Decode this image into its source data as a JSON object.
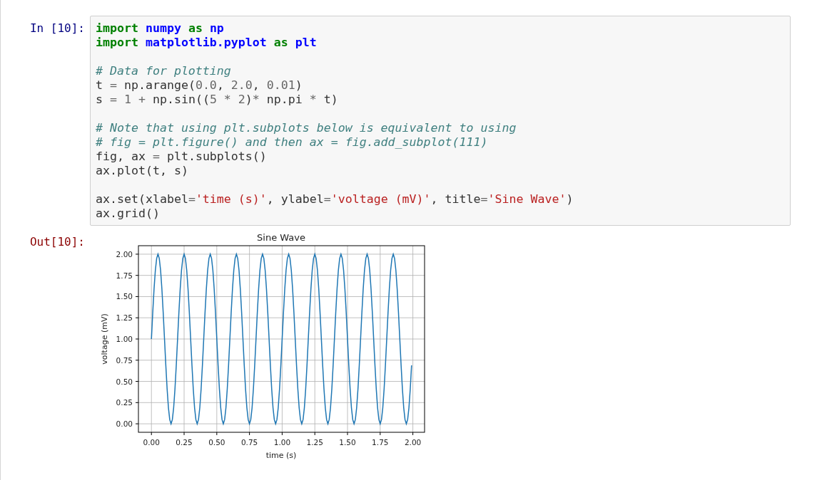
{
  "input_cell": {
    "prompt": "In [10]:",
    "code_blocks": [
      [
        [
          {
            "text": "import",
            "kind": "keyword"
          },
          {
            "text": " numpy",
            "kind": "name"
          },
          {
            "text": " as",
            "kind": "keyword"
          },
          {
            "text": " np",
            "kind": "name"
          }
        ],
        [
          {
            "text": "import",
            "kind": "keyword"
          },
          {
            "text": " matplotlib.pyplot",
            "kind": "name"
          },
          {
            "text": " as",
            "kind": "keyword"
          },
          {
            "text": " plt",
            "kind": "name"
          }
        ]
      ],
      [
        [
          {
            "text": "# Data for plotting",
            "kind": "comment"
          }
        ],
        [
          {
            "text": "t ",
            "kind": "plain"
          },
          {
            "text": "=",
            "kind": "operator"
          },
          {
            "text": " np.arange(",
            "kind": "plain"
          },
          {
            "text": "0.0",
            "kind": "number"
          },
          {
            "text": ", ",
            "kind": "plain"
          },
          {
            "text": "2.0",
            "kind": "number"
          },
          {
            "text": ", ",
            "kind": "plain"
          },
          {
            "text": "0.01",
            "kind": "number"
          },
          {
            "text": ")",
            "kind": "plain"
          }
        ],
        [
          {
            "text": "s ",
            "kind": "plain"
          },
          {
            "text": "=",
            "kind": "operator"
          },
          {
            "text": " 1",
            "kind": "number"
          },
          {
            "text": " +",
            "kind": "operator"
          },
          {
            "text": " np.sin((",
            "kind": "plain"
          },
          {
            "text": "5",
            "kind": "number"
          },
          {
            "text": " *",
            "kind": "operator"
          },
          {
            "text": " 2",
            "kind": "number"
          },
          {
            "text": ")",
            "kind": "plain"
          },
          {
            "text": "*",
            "kind": "operator"
          },
          {
            "text": " np.pi ",
            "kind": "plain"
          },
          {
            "text": "*",
            "kind": "operator"
          },
          {
            "text": " t)",
            "kind": "plain"
          }
        ]
      ],
      [
        [
          {
            "text": "# Note that using plt.subplots below is equivalent to using",
            "kind": "comment"
          }
        ],
        [
          {
            "text": "# fig = plt.figure() and then ax = fig.add_subplot(111)",
            "kind": "comment"
          }
        ],
        [
          {
            "text": "fig, ax ",
            "kind": "plain"
          },
          {
            "text": "=",
            "kind": "operator"
          },
          {
            "text": " plt.subplots()",
            "kind": "plain"
          }
        ],
        [
          {
            "text": "ax.plot(t, s)",
            "kind": "plain"
          }
        ]
      ],
      [
        [
          {
            "text": "ax.set(xlabel",
            "kind": "plain"
          },
          {
            "text": "=",
            "kind": "operator"
          },
          {
            "text": "'time (s)'",
            "kind": "string"
          },
          {
            "text": ", ylabel",
            "kind": "plain"
          },
          {
            "text": "=",
            "kind": "operator"
          },
          {
            "text": "'voltage (mV)'",
            "kind": "string"
          },
          {
            "text": ", title",
            "kind": "plain"
          },
          {
            "text": "=",
            "kind": "operator"
          },
          {
            "text": "'Sine Wave'",
            "kind": "string"
          },
          {
            "text": ")",
            "kind": "plain"
          }
        ],
        [
          {
            "text": "ax.grid()",
            "kind": "plain"
          }
        ]
      ]
    ]
  },
  "output_cell": {
    "prompt": "Out[10]:",
    "chart_data": {
      "type": "line",
      "title": "Sine Wave",
      "xlabel": "time (s)",
      "ylabel": "voltage (mV)",
      "x": [
        0,
        0.01,
        0.02,
        0.03,
        0.04,
        0.05,
        0.06,
        0.07,
        0.08,
        0.09,
        0.1,
        0.11,
        0.12,
        0.13,
        0.14,
        0.15,
        0.16,
        0.17,
        0.18,
        0.19,
        0.2,
        0.21,
        0.22,
        0.23,
        0.24,
        0.25,
        0.26,
        0.27,
        0.28,
        0.29,
        0.3,
        0.31,
        0.32,
        0.33,
        0.34,
        0.35,
        0.36,
        0.37,
        0.38,
        0.39,
        0.4,
        0.41,
        0.42,
        0.43,
        0.44,
        0.45,
        0.46,
        0.47,
        0.48,
        0.49,
        0.5,
        0.51,
        0.52,
        0.53,
        0.54,
        0.55,
        0.56,
        0.57,
        0.58,
        0.59,
        0.6,
        0.61,
        0.62,
        0.63,
        0.64,
        0.65,
        0.66,
        0.67,
        0.68,
        0.69,
        0.7,
        0.71,
        0.72,
        0.73,
        0.74,
        0.75,
        0.76,
        0.77,
        0.78,
        0.79,
        0.8,
        0.81,
        0.82,
        0.83,
        0.84,
        0.85,
        0.86,
        0.87,
        0.88,
        0.89,
        0.9,
        0.91,
        0.92,
        0.93,
        0.94,
        0.95,
        0.96,
        0.97,
        0.98,
        0.99,
        1,
        1.01,
        1.02,
        1.03,
        1.04,
        1.05,
        1.06,
        1.07,
        1.08,
        1.09,
        1.1,
        1.11,
        1.12,
        1.13,
        1.14,
        1.15,
        1.16,
        1.17,
        1.18,
        1.19,
        1.2,
        1.21,
        1.22,
        1.23,
        1.24,
        1.25,
        1.26,
        1.27,
        1.28,
        1.29,
        1.3,
        1.31,
        1.32,
        1.33,
        1.34,
        1.35,
        1.36,
        1.37,
        1.38,
        1.39,
        1.4,
        1.41,
        1.42,
        1.43,
        1.44,
        1.45,
        1.46,
        1.47,
        1.48,
        1.49,
        1.5,
        1.51,
        1.52,
        1.53,
        1.54,
        1.55,
        1.56,
        1.57,
        1.58,
        1.59,
        1.6,
        1.61,
        1.62,
        1.63,
        1.64,
        1.65,
        1.66,
        1.67,
        1.68,
        1.69,
        1.7,
        1.71,
        1.72,
        1.73,
        1.74,
        1.75,
        1.76,
        1.77,
        1.78,
        1.79,
        1.8,
        1.81,
        1.82,
        1.83,
        1.84,
        1.85,
        1.86,
        1.87,
        1.88,
        1.89,
        1.9,
        1.91,
        1.92,
        1.93,
        1.94,
        1.95,
        1.96,
        1.97,
        1.98,
        1.99
      ],
      "series": [
        {
          "color": "#1f77b4",
          "values": [
            1,
            1.31,
            1.59,
            1.81,
            1.95,
            2,
            1.95,
            1.81,
            1.59,
            1.31,
            1,
            0.69,
            0.41,
            0.19,
            0.05,
            0,
            0.05,
            0.19,
            0.41,
            0.69,
            1,
            1.31,
            1.59,
            1.81,
            1.95,
            2,
            1.95,
            1.81,
            1.59,
            1.31,
            1,
            0.69,
            0.41,
            0.19,
            0.05,
            0,
            0.05,
            0.19,
            0.41,
            0.69,
            1,
            1.31,
            1.59,
            1.81,
            1.95,
            2,
            1.95,
            1.81,
            1.59,
            1.31,
            1,
            0.69,
            0.41,
            0.19,
            0.05,
            0,
            0.05,
            0.19,
            0.41,
            0.69,
            1,
            1.31,
            1.59,
            1.81,
            1.95,
            2,
            1.95,
            1.81,
            1.59,
            1.31,
            1,
            0.69,
            0.41,
            0.19,
            0.05,
            0,
            0.05,
            0.19,
            0.41,
            0.69,
            1,
            1.31,
            1.59,
            1.81,
            1.95,
            2,
            1.95,
            1.81,
            1.59,
            1.31,
            1,
            0.69,
            0.41,
            0.19,
            0.05,
            0,
            0.05,
            0.19,
            0.41,
            0.69,
            1,
            1.31,
            1.59,
            1.81,
            1.95,
            2,
            1.95,
            1.81,
            1.59,
            1.31,
            1,
            0.69,
            0.41,
            0.19,
            0.05,
            0,
            0.05,
            0.19,
            0.41,
            0.69,
            1,
            1.31,
            1.59,
            1.81,
            1.95,
            2,
            1.95,
            1.81,
            1.59,
            1.31,
            1,
            0.69,
            0.41,
            0.19,
            0.05,
            0,
            0.05,
            0.19,
            0.41,
            0.69,
            1,
            1.31,
            1.59,
            1.81,
            1.95,
            2,
            1.95,
            1.81,
            1.59,
            1.31,
            1,
            0.69,
            0.41,
            0.19,
            0.05,
            0,
            0.05,
            0.19,
            0.41,
            0.69,
            1,
            1.31,
            1.59,
            1.81,
            1.95,
            2,
            1.95,
            1.81,
            1.59,
            1.31,
            1,
            0.69,
            0.41,
            0.19,
            0.05,
            0,
            0.05,
            0.19,
            0.41,
            0.69,
            1,
            1.31,
            1.59,
            1.81,
            1.95,
            2,
            1.95,
            1.81,
            1.59,
            1.31,
            1,
            0.69,
            0.41,
            0.19,
            0.05,
            0,
            0.05,
            0.19,
            0.41,
            0.69
          ]
        }
      ],
      "xlim": [
        -0.0995,
        2.0895
      ],
      "ylim": [
        -0.1,
        2.1
      ],
      "grid": true,
      "xticks": [
        {
          "value": 0,
          "label": "0.00"
        },
        {
          "value": 0.25,
          "label": "0.25"
        },
        {
          "value": 0.5,
          "label": "0.50"
        },
        {
          "value": 0.75,
          "label": "0.75"
        },
        {
          "value": 1,
          "label": "1.00"
        },
        {
          "value": 1.25,
          "label": "1.25"
        },
        {
          "value": 1.5,
          "label": "1.50"
        },
        {
          "value": 1.75,
          "label": "1.75"
        },
        {
          "value": 2,
          "label": "2.00"
        }
      ],
      "yticks": [
        {
          "value": 0,
          "label": "0.00"
        },
        {
          "value": 0.25,
          "label": "0.25"
        },
        {
          "value": 0.5,
          "label": "0.50"
        },
        {
          "value": 0.75,
          "label": "0.75"
        },
        {
          "value": 1,
          "label": "1.00"
        },
        {
          "value": 1.25,
          "label": "1.25"
        },
        {
          "value": 1.5,
          "label": "1.50"
        },
        {
          "value": 1.75,
          "label": "1.75"
        },
        {
          "value": 2,
          "label": "2.00"
        }
      ]
    }
  }
}
